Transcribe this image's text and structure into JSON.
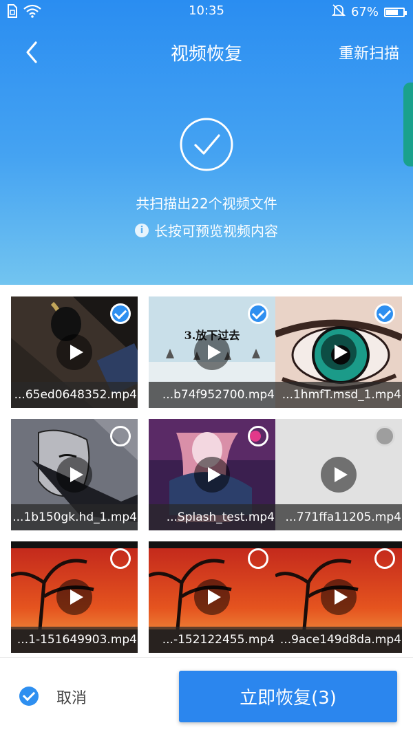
{
  "status_bar": {
    "time": "10:35",
    "battery_percent_text": "67%",
    "battery_level": 0.67,
    "icons": [
      "sim-icon",
      "wifi-icon",
      "silent-bell-icon",
      "battery-icon"
    ]
  },
  "nav": {
    "back_icon": "chevron-left-icon",
    "title": "视频恢复",
    "rescan_label": "重新扫描"
  },
  "scan": {
    "icon": "check-circle-icon",
    "result_text": "共扫描出22个视频文件",
    "info_icon": "i",
    "hint_text": "长按可预览视频内容"
  },
  "videos": [
    {
      "name": "...65ed0648352.mp4",
      "state": "selected"
    },
    {
      "name": "...b74f952700.mp4",
      "state": "selected"
    },
    {
      "name": "...1hmfT.msd_1.mp4",
      "state": "selected"
    },
    {
      "name": "...1b150gk.hd_1.mp4",
      "state": "unselected"
    },
    {
      "name": "...Splash_test.mp4",
      "state": "unselected"
    },
    {
      "name": "...771ffa11205.mp4",
      "state": "disabled"
    },
    {
      "name": "...1-151649903.mp4",
      "state": "unselected"
    },
    {
      "name": "...-152122455.mp4",
      "state": "unselected"
    },
    {
      "name": "...9ace149d8da.mp4",
      "state": "unselected"
    }
  ],
  "thumb_text": {
    "tile2_caption": "3.放下过去"
  },
  "footer": {
    "cancel_label": "取消",
    "recover_label": "立即恢复(3)"
  },
  "colors": {
    "accent": "#2e8ff0",
    "header_top": "#2a8df1",
    "header_bottom": "#72c4f0",
    "side_tab": "#1aa18c"
  }
}
